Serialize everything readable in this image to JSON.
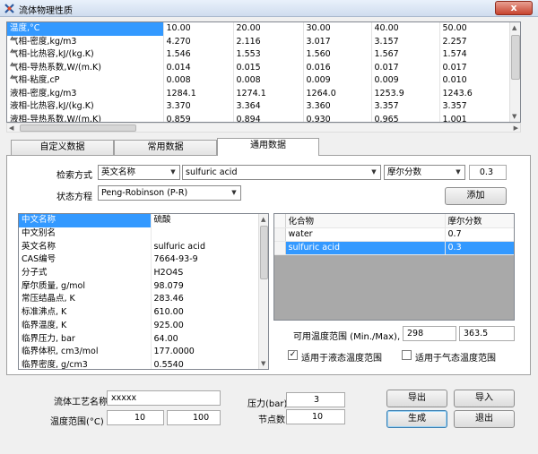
{
  "window": {
    "title": "流体物理性质",
    "close": "x"
  },
  "top_grid": {
    "rows": [
      [
        "温度,°C",
        "10.00",
        "20.00",
        "30.00",
        "40.00",
        "50.00"
      ],
      [
        "气相-密度,kg/m3",
        "4.270",
        "2.116",
        "3.017",
        "3.157",
        "2.257"
      ],
      [
        "气相-比热容,kJ/(kg.K)",
        "1.546",
        "1.553",
        "1.560",
        "1.567",
        "1.574"
      ],
      [
        "气相-导热系数,W/(m.K)",
        "0.014",
        "0.015",
        "0.016",
        "0.017",
        "0.017"
      ],
      [
        "气相-粘度,cP",
        "0.008",
        "0.008",
        "0.009",
        "0.009",
        "0.010"
      ],
      [
        "液相-密度,kg/m3",
        "1284.1",
        "1274.1",
        "1264.0",
        "1253.9",
        "1243.6"
      ],
      [
        "液相-比热容,kJ/(kg.K)",
        "3.370",
        "3.364",
        "3.360",
        "3.357",
        "3.357"
      ],
      [
        "液相-导热系数,W/(m.K)",
        "0.859",
        "0.894",
        "0.930",
        "0.965",
        "1.001"
      ]
    ]
  },
  "tabs": [
    {
      "label": "自定义数据"
    },
    {
      "label": "常用数据"
    },
    {
      "label": "通用数据"
    }
  ],
  "search": {
    "label": "检索方式",
    "mode": "英文名称",
    "substance": "sulfuric acid",
    "fraction_type": "摩尔分数",
    "fraction_value": "0.3"
  },
  "eos": {
    "label": "状态方程",
    "value": "Peng-Robinson (P-R)"
  },
  "add_button": "添加",
  "properties": {
    "rows": [
      [
        "中文名称",
        "硫酸"
      ],
      [
        "中文别名",
        ""
      ],
      [
        "英文名称",
        "sulfuric acid"
      ],
      [
        "CAS编号",
        "7664-93-9"
      ],
      [
        "分子式",
        "H2O4S"
      ],
      [
        "摩尔质量, g/mol",
        "98.079"
      ],
      [
        "常压结晶点, K",
        "283.46"
      ],
      [
        "标准沸点, K",
        "610.00"
      ],
      [
        "临界温度, K",
        "925.00"
      ],
      [
        "临界压力, bar",
        "64.00"
      ],
      [
        "临界体积, cm3/mol",
        "177.0000"
      ],
      [
        "临界密度, g/cm3",
        "0.5540"
      ]
    ]
  },
  "components": {
    "headers": [
      "化合物",
      "摩尔分数"
    ],
    "rows": [
      [
        "water",
        "0.7"
      ],
      [
        "sulfuric acid",
        "0.3"
      ]
    ]
  },
  "temp_range": {
    "label": "可用温度范围 (Min./Max), K",
    "min": "298",
    "max": "363.5"
  },
  "checks": {
    "liquid": {
      "label": "适用于液态温度范围",
      "checked": true
    },
    "gas": {
      "label": "适用于气态温度范围",
      "checked": false
    }
  },
  "bottom": {
    "process_name_label": "流体工艺名称",
    "process_name": "xxxxx",
    "temp_range_label": "温度范围(°C)",
    "temp_min": "10",
    "temp_max": "100",
    "pressure_label": "压力(bar)",
    "pressure": "3",
    "nodes_label": "节点数",
    "nodes": "10",
    "export": "导出",
    "import": "导入",
    "generate": "生成",
    "exit": "退出"
  },
  "colors": {
    "selection": "#3399ff",
    "close": "#c7432e"
  }
}
